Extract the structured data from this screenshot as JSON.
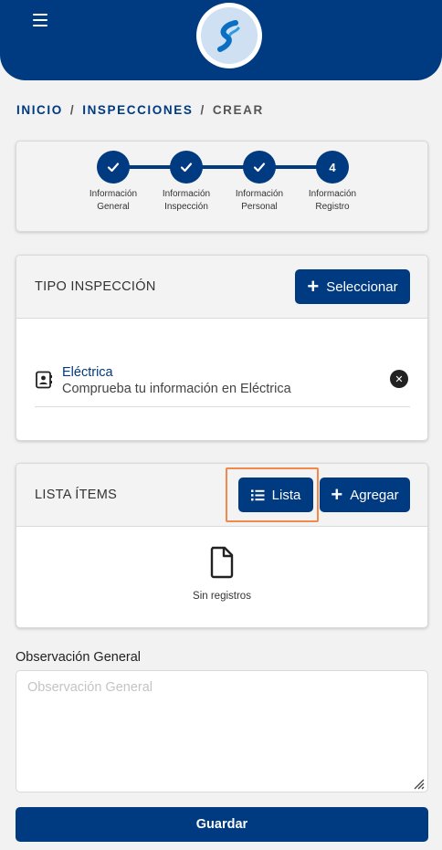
{
  "header": {
    "menu_icon": "hamburger-icon",
    "logo_icon": "brand-logo-icon"
  },
  "breadcrumb": {
    "items": [
      "INICIO",
      "INSPECCIONES",
      "CREAR"
    ],
    "separator": "/"
  },
  "stepper": {
    "steps": [
      {
        "label_line1": "Información",
        "label_line2": "General",
        "state": "done",
        "icon": "check-icon"
      },
      {
        "label_line1": "Información",
        "label_line2": "Inspección",
        "state": "done",
        "icon": "check-icon"
      },
      {
        "label_line1": "Información",
        "label_line2": "Personal",
        "state": "done",
        "icon": "check-icon"
      },
      {
        "number": "4",
        "label_line1": "Información",
        "label_line2": "Registro",
        "state": "current"
      }
    ]
  },
  "tipo_inspeccion": {
    "title": "TIPO INSPECCIÓN",
    "select_button": "Seleccionar",
    "item": {
      "title": "Eléctrica",
      "description": "Comprueba tu información en Eléctrica",
      "icon": "contact-book-icon"
    }
  },
  "lista_items": {
    "title": "LISTA ÍTEMS",
    "list_button": "Lista",
    "add_button": "Agregar",
    "empty_text": "Sin registros",
    "empty_icon": "document-icon"
  },
  "observacion": {
    "label": "Observación General",
    "placeholder": "Observación General",
    "value": ""
  },
  "save_button": "Guardar",
  "colors": {
    "primary": "#003a80",
    "highlight": "#f0894a",
    "background": "#f2f2f2"
  }
}
